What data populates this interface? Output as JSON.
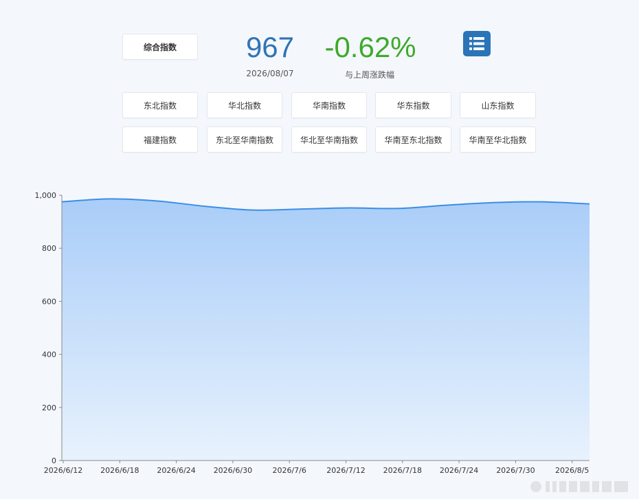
{
  "main_button": "综合指数",
  "current_value": "967",
  "current_date": "2026/08/07",
  "weekly_change": "-0.62%",
  "weekly_change_label": "与上周涨跌幅",
  "region_buttons": [
    "华北指数",
    "东北指数",
    "华南指数",
    "华东指数",
    "山东指数",
    "东北至华南指数",
    "福建指数",
    "华北至华南指数",
    "华南至东北指数",
    "华南至华北指数"
  ],
  "colors": {
    "value": "#2f74b5",
    "change": "#3ea92a",
    "line": "#3a8ee6",
    "icon_bg": "#2a74b7"
  },
  "icon": "list-icon",
  "chart_data": {
    "type": "area",
    "x": [
      "2026/6/12",
      "2026/6/18",
      "2026/6/24",
      "2026/6/30",
      "2026/7/6",
      "2026/7/12",
      "2026/7/18",
      "2026/7/24",
      "2026/7/30",
      "2026/8/5"
    ],
    "series": [
      {
        "values": [
          975,
          986,
          978,
          958,
          944,
          948,
          952,
          950,
          962,
          972,
          975,
          967
        ]
      }
    ],
    "y_ticks": [
      "0",
      "200",
      "400",
      "600",
      "800",
      "1,000"
    ],
    "ylim": [
      0,
      1000
    ],
    "grid": false,
    "title": "",
    "xlabel": "",
    "ylabel": ""
  }
}
